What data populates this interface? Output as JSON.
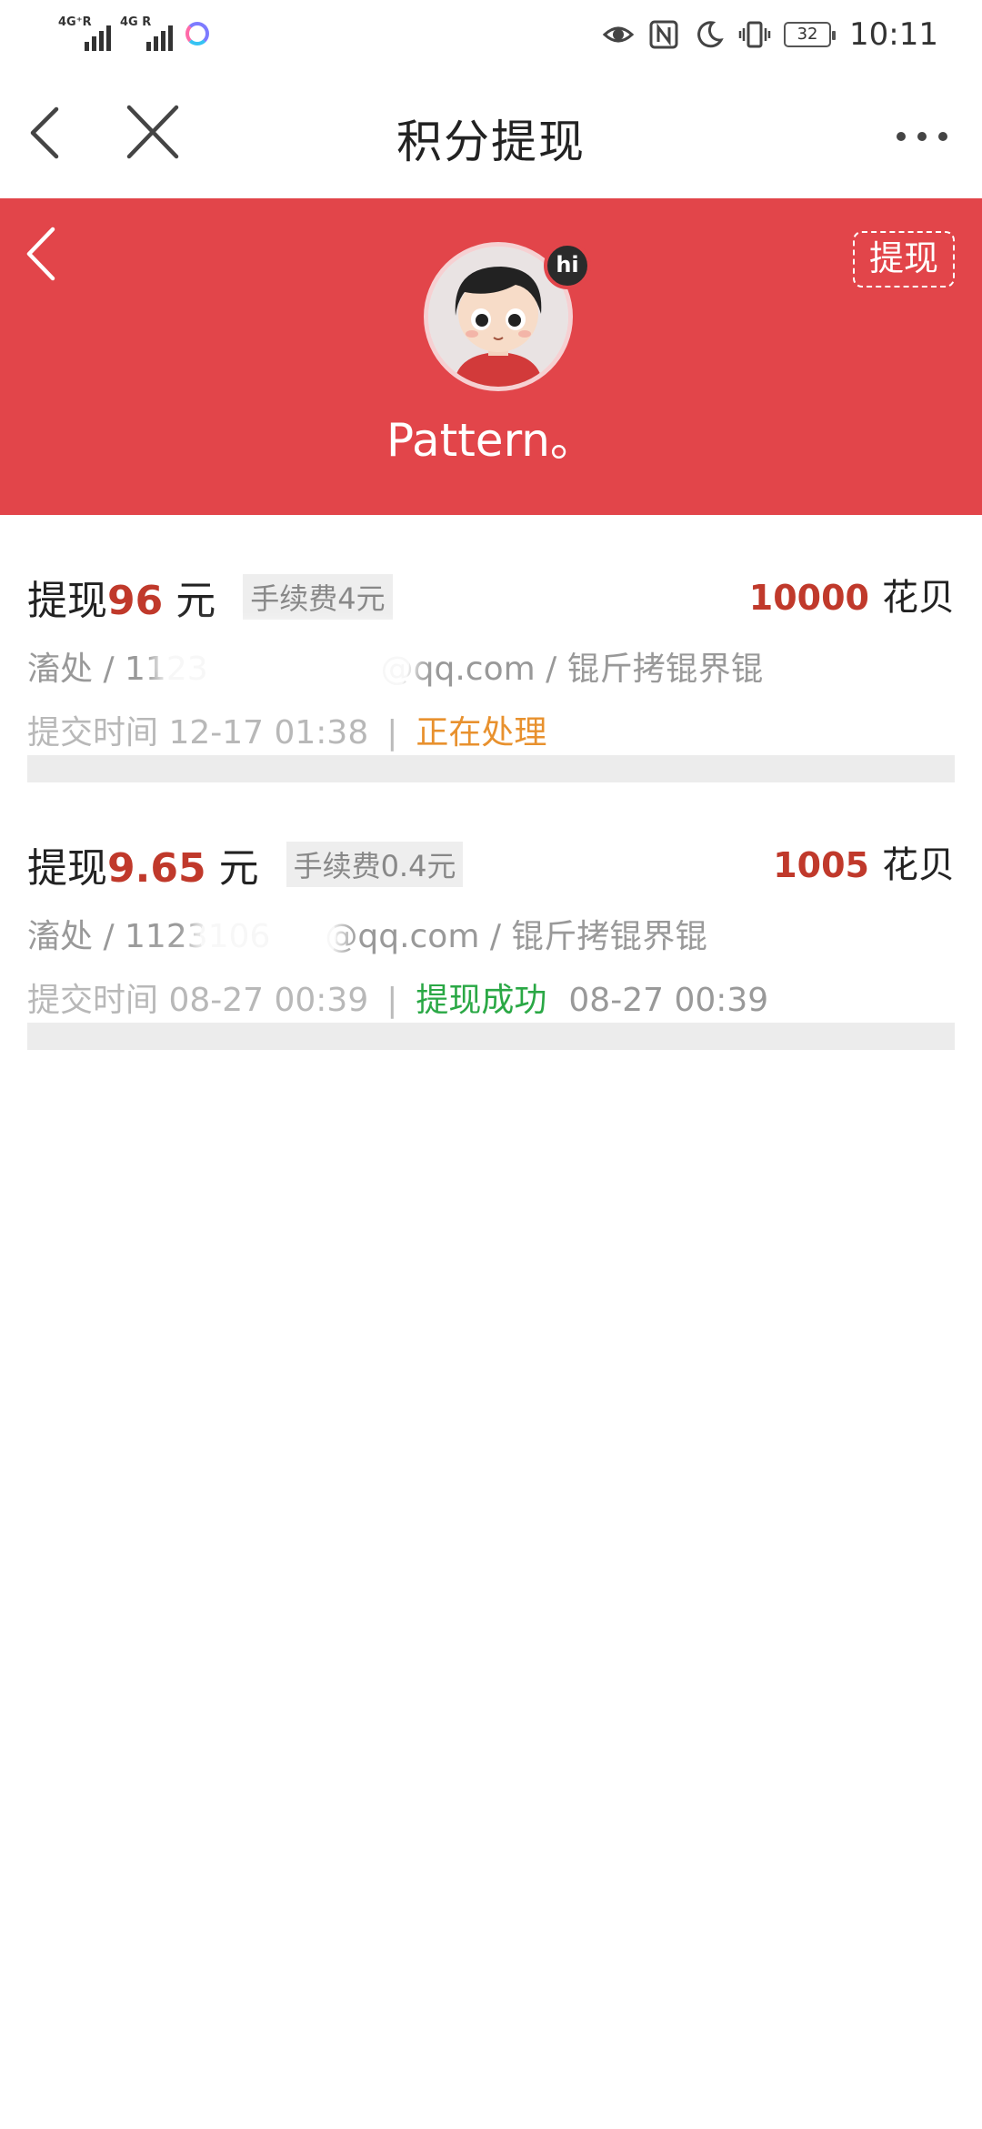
{
  "status_bar": {
    "signal1_label": "4G⁺R",
    "signal2_label": "4G R",
    "battery": "32",
    "time": "10:11",
    "icons": [
      "eye-icon",
      "nfc-icon",
      "moon-icon",
      "vibrate-icon",
      "battery-icon"
    ]
  },
  "nav": {
    "title": "积分提现",
    "icons": [
      "back-icon",
      "close-icon",
      "more-icon"
    ]
  },
  "header": {
    "username": "Pattern。",
    "badge": "hi",
    "withdraw_label": "提现",
    "background_color": "#e2454a"
  },
  "records": [
    {
      "prefix": "提现",
      "amount": "96",
      "unit": "元",
      "fee": "手续费4元",
      "points": "10000",
      "points_unit": "花贝",
      "account": "滀处 / 1123",
      "account_suffix": "@qq.com / 锟斤拷锟界锟",
      "time": "提交时间 12-17 01:38",
      "separator": "|",
      "status": "正在处理",
      "status_color": "#e8912e",
      "extra": ""
    },
    {
      "prefix": "提现",
      "amount": "9.65",
      "unit": "元",
      "fee": "手续费0.4元",
      "points": "1005",
      "points_unit": "花贝",
      "account": "滀处 / 1123106",
      "account_suffix": "@qq.com / 锟斤拷锟界锟",
      "time": "提交时间 08-27 00:39",
      "separator": "|",
      "status": "提现成功",
      "status_color": "#2aa845",
      "extra": "08-27 00:39"
    }
  ],
  "colors": {
    "accent_red": "#c0392b",
    "processing": "#e8912e",
    "success": "#2aa845"
  }
}
